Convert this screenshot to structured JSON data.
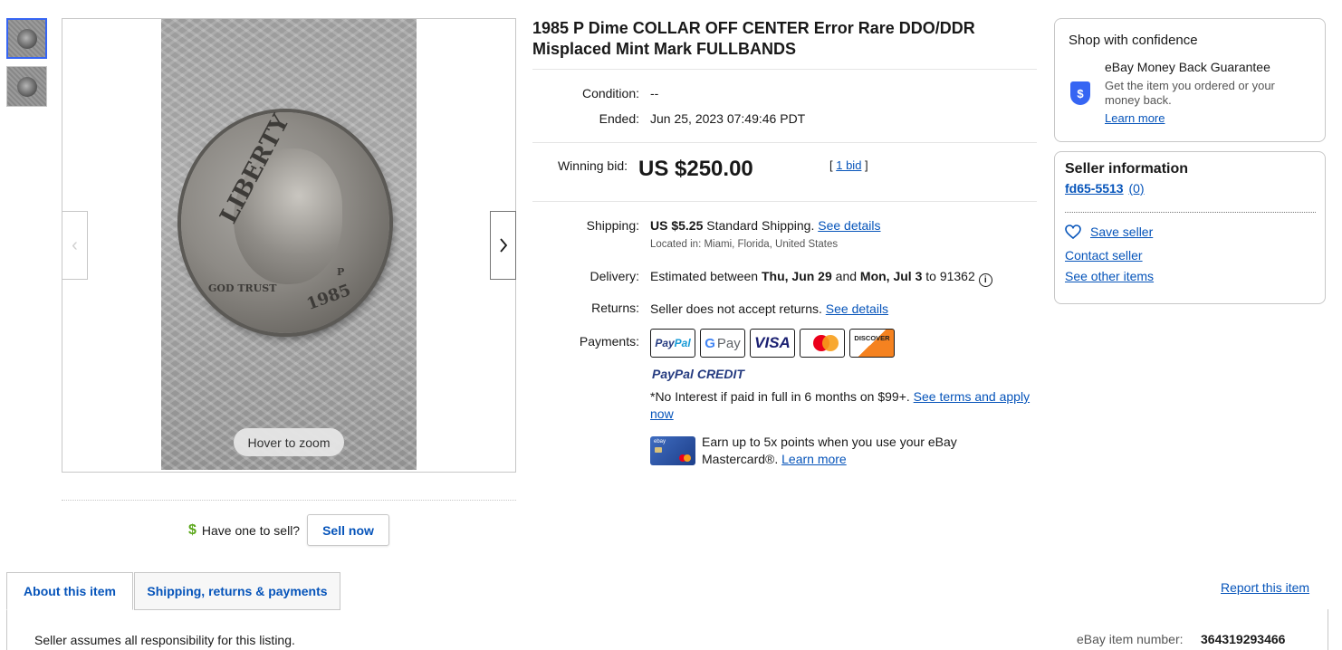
{
  "listing": {
    "title": "1985 P Dime COLLAR OFF CENTER Error Rare DDO/DDR Misplaced Mint Mark FULLBANDS",
    "condition_label": "Condition:",
    "condition_value": "--",
    "ended_label": "Ended:",
    "ended_value": "Jun 25, 2023 07:49:46 PDT",
    "winning_bid_label": "Winning bid:",
    "winning_bid_value": "US $250.00",
    "bid_count": "1 bid"
  },
  "gallery": {
    "zoom_hint": "Hover to zoom",
    "coin_text": {
      "liberty": "LIBERTY",
      "motto": "GOD TRUST",
      "year": "1985",
      "mint": "P"
    }
  },
  "sell": {
    "prompt": "Have one to sell?",
    "button": "Sell now"
  },
  "shipping": {
    "label": "Shipping:",
    "cost": "US $5.25",
    "method": " Standard Shipping. ",
    "details_link": "See details",
    "located": "Located in: Miami, Florida, United States"
  },
  "delivery": {
    "label": "Delivery:",
    "prefix": "Estimated between ",
    "date1": "Thu, Jun 29",
    "and": " and ",
    "date2": "Mon, Jul 3",
    "suffix": " to 91362"
  },
  "returns": {
    "label": "Returns:",
    "text": "Seller does not accept returns. ",
    "link": "See details"
  },
  "payments": {
    "label": "Payments:",
    "methods": [
      "PayPal",
      "G Pay",
      "VISA",
      "Mastercard",
      "DISCOVER"
    ],
    "paypal_credit_pay": "PayPal",
    "paypal_credit_credit": "CREDIT",
    "no_interest": "*No Interest if paid in full in 6 months on $99+. ",
    "terms_link": "See terms and apply now",
    "earn_text": "Earn up to 5x points when you use your eBay Mastercard®. ",
    "earn_link": "Learn more",
    "card_brand": "ebay"
  },
  "confidence": {
    "title": "Shop with confidence",
    "guarantee_title": "eBay Money Back Guarantee",
    "guarantee_text": "Get the item you ordered or your money back.",
    "learn_more": "Learn more"
  },
  "seller": {
    "title": "Seller information",
    "name": "fd65-5513",
    "feedback": "(0)",
    "save": "Save seller",
    "contact": "Contact seller",
    "other_items": "See other items"
  },
  "tabs": [
    "About this item",
    "Shipping, returns & payments"
  ],
  "footer": {
    "report": "Report this item",
    "assume": "Seller assumes all responsibility for this listing.",
    "item_number_label": "eBay item number:",
    "item_number": "364319293466"
  },
  "colors": {
    "link": "#0654ba",
    "accent": "#3665f3",
    "sell_dollar": "#5ba71b"
  }
}
